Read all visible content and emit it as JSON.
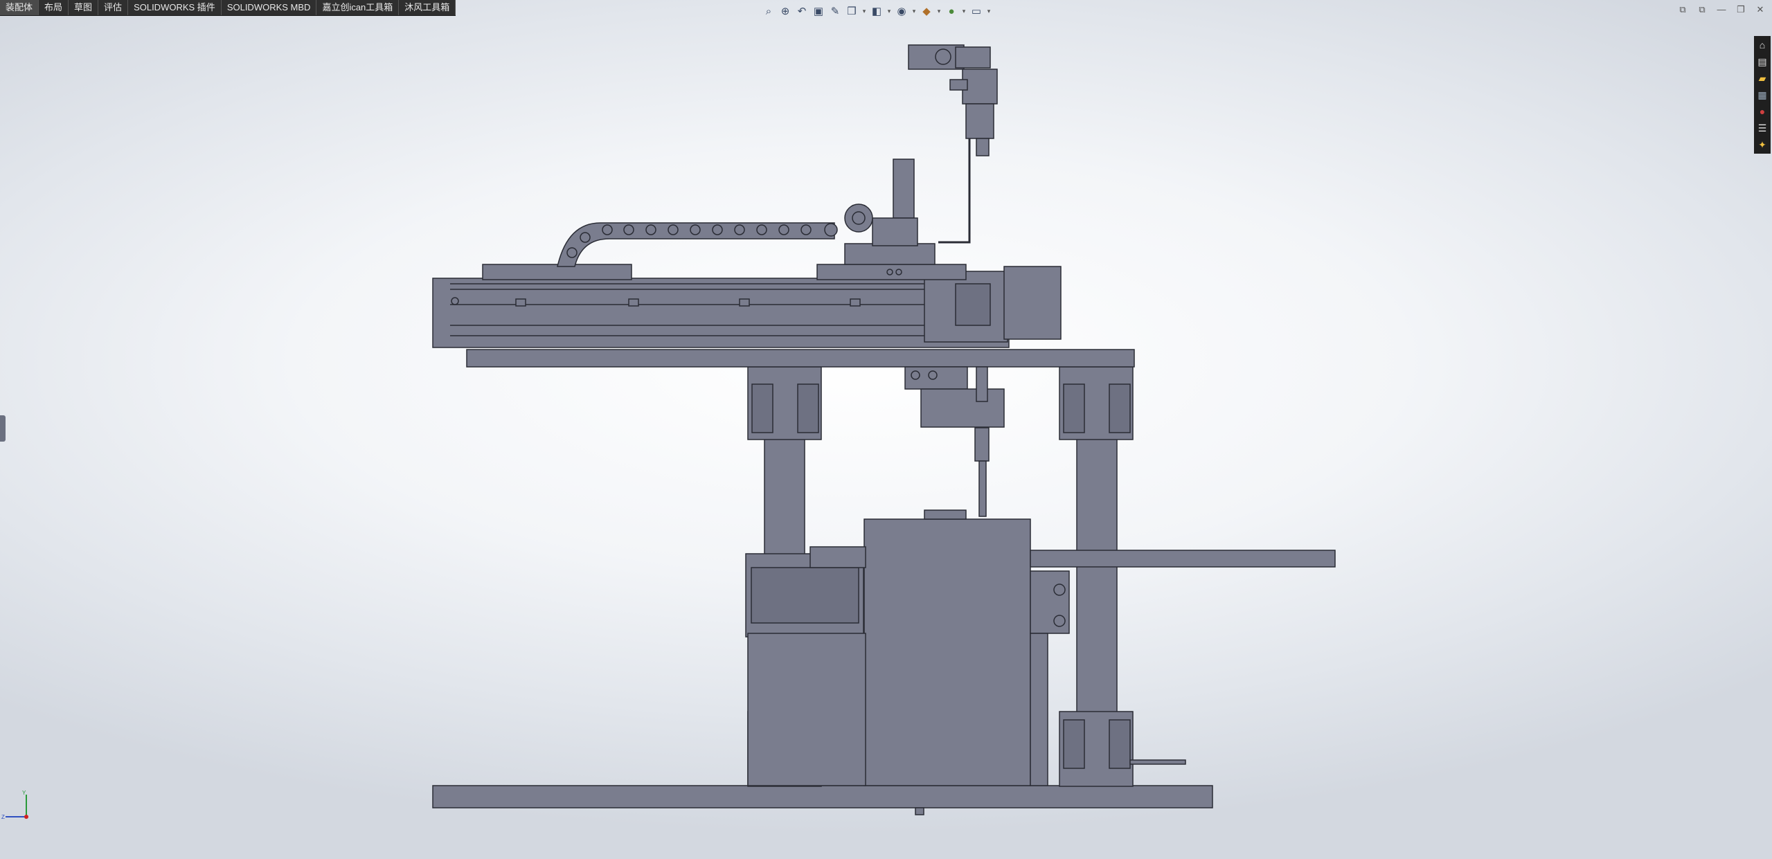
{
  "command_tabs": {
    "items": [
      {
        "label": "装配体"
      },
      {
        "label": "布局"
      },
      {
        "label": "草图"
      },
      {
        "label": "评估"
      },
      {
        "label": "SOLIDWORKS 插件"
      },
      {
        "label": "SOLIDWORKS MBD"
      },
      {
        "label": "嘉立创ican工具箱"
      },
      {
        "label": "沐风工具箱"
      }
    ],
    "active_index": 0
  },
  "heads_up_toolbar": {
    "icons": [
      "zoom-to-fit-icon",
      "zoom-to-area-icon",
      "previous-view-icon",
      "section-view-icon",
      "dynamic-annotation-icon",
      "view-orientation-icon",
      "display-style-icon",
      "hide-show-items-icon",
      "edit-appearance-icon",
      "apply-scene-icon",
      "view-settings-icon"
    ]
  },
  "window_controls": [
    "tile-left-icon",
    "tile-right-icon",
    "minimize-icon",
    "restore-icon",
    "close-icon"
  ],
  "task_pane": {
    "icons": [
      "solidworks-resources-icon",
      "design-library-icon",
      "file-explorer-icon",
      "view-palette-icon",
      "appearances-scenes-icon",
      "custom-properties-icon",
      "forum-icon"
    ]
  },
  "triad": {
    "axes": [
      "Y",
      "Z"
    ]
  },
  "colors": {
    "part_fill": "#7a7d8e",
    "part_edge": "#2a2c35",
    "background": "#eef1f5",
    "tab_bar": "#2f2f2f"
  }
}
